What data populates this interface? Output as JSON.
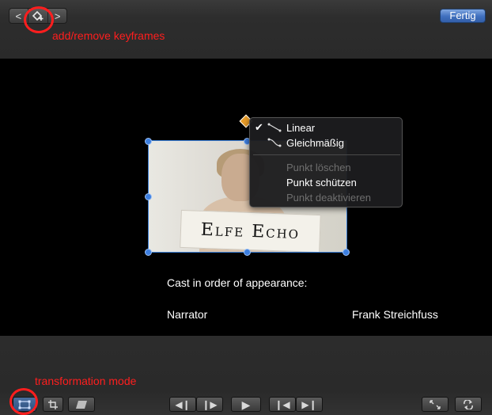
{
  "toolbar": {
    "prev_label": "<",
    "keyframe_icon": "add-keyframe-icon",
    "next_label": ">",
    "done_label": "Fertig"
  },
  "annotations": {
    "keyframes": "add/remove keyframes",
    "transform": "transformation mode"
  },
  "viewer": {
    "sign_text": "Elfe Echo",
    "cast_title": "Cast in order of appearance:",
    "credit_role": "Narrator",
    "credit_name": "Frank Streichfuss"
  },
  "context_menu": {
    "items": [
      {
        "label": "Linear",
        "checked": true,
        "enabled": true,
        "icon": "linear-curve-icon"
      },
      {
        "label": "Gleichmäßig",
        "checked": false,
        "enabled": true,
        "icon": "smooth-curve-icon"
      },
      {
        "label": "Punkt löschen",
        "enabled": false
      },
      {
        "label": "Punkt schützen",
        "enabled": true
      },
      {
        "label": "Punkt deaktivieren",
        "enabled": false
      }
    ]
  },
  "bottom_toolbar": {
    "buttons": [
      "transform-icon",
      "crop-icon",
      "distort-icon",
      "prev-frame-icon",
      "next-frame-icon",
      "play-icon",
      "go-to-start-icon",
      "go-to-end-icon",
      "fullscreen-icon",
      "loop-icon"
    ]
  },
  "colors": {
    "accent_blue": "#3d7fe0",
    "annotation_red": "#ff1e1e",
    "control_point_orange": "#e79b27"
  }
}
